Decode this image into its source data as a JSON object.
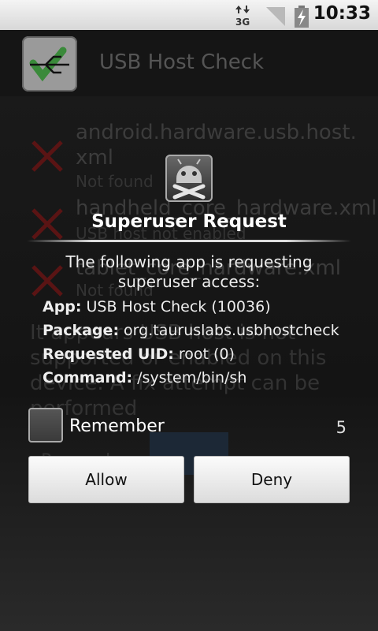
{
  "statusbar": {
    "network": "3G",
    "time": "10:33"
  },
  "app": {
    "title": "USB Host Check",
    "checks": [
      {
        "name": "android.hardware.usb.host.\nxml",
        "status": "Not found"
      },
      {
        "name": "handheld_core_hardware.xml",
        "status": "USB host not enabled"
      },
      {
        "name": "tablet_core_hardware.xml",
        "status": "Not found"
      }
    ],
    "verdict": "It appears USB host is not supported or enabled on this device. A fix attempt can be performed",
    "bottom_text": "Proceed"
  },
  "dialog": {
    "title": "Superuser Request",
    "message": "The following app is requesting superuser access:",
    "app_label": "App:",
    "app_value": "USB Host Check (10036)",
    "package_label": "Package:",
    "package_value": "org.tauruslabs.usbhostcheck",
    "uid_label": "Requested UID:",
    "uid_value": "root (0)",
    "command_label": "Command:",
    "command_value": "/system/bin/sh",
    "remember_label": "Remember",
    "countdown": "5",
    "allow_label": "Allow",
    "deny_label": "Deny"
  },
  "colors": {
    "error_x": "#8b1a1a",
    "check_green": "#2e9a2e"
  }
}
